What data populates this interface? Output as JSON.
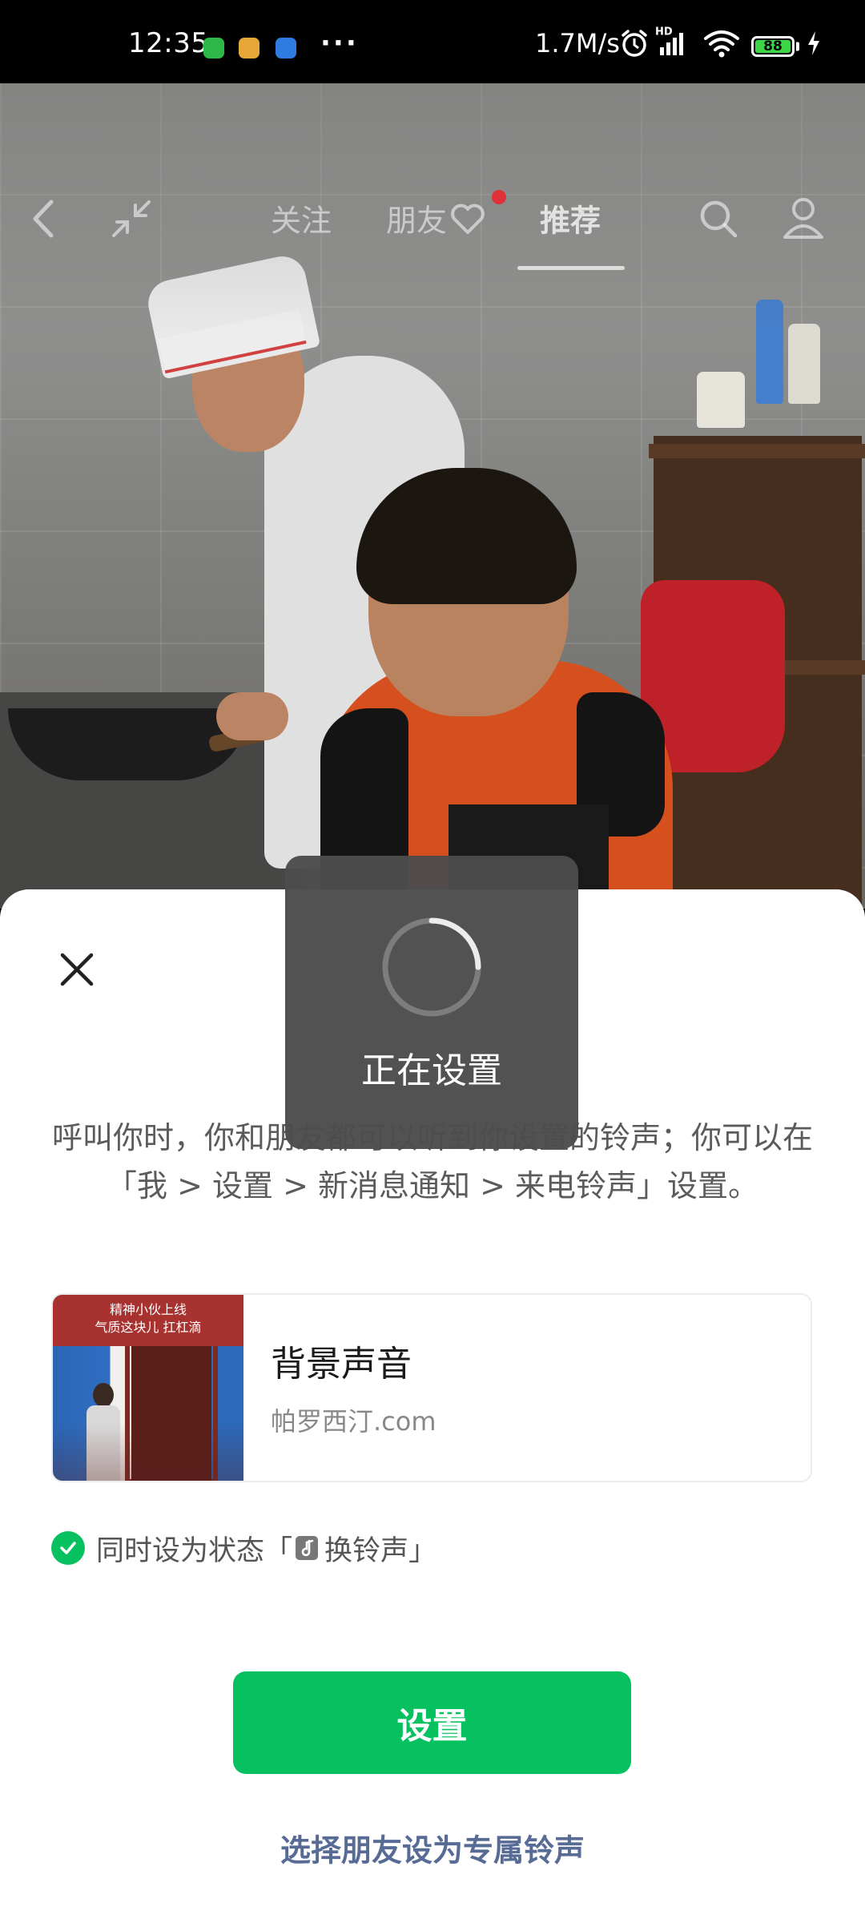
{
  "status_bar": {
    "time": "12:35",
    "dots": "···",
    "net_speed": "1.7M/s",
    "network_label": "HD",
    "battery": "88",
    "battery_color": "#3cd548"
  },
  "nav": {
    "tabs": [
      {
        "label": "关注"
      },
      {
        "label": "朋友"
      },
      {
        "label": "推荐"
      }
    ],
    "active_tab": "推荐",
    "icons": [
      "back-icon",
      "collapse-icon",
      "heart-icon",
      "search-icon",
      "profile-icon"
    ]
  },
  "loading": {
    "text": "正在设置"
  },
  "sheet": {
    "description": "呼叫你时，你和朋友都可以听到你设置的铃声；你可以在「我 > 设置 > 新消息通知 > 来电铃声」设置。",
    "ringtone": {
      "title": "背景声音",
      "subtitle": "帕罗西汀.com",
      "thumbnail_caption_line1": "精神小伙上线",
      "thumbnail_caption_line2": "气质这块儿 扛杠滴"
    },
    "status_option": {
      "checked": true,
      "prefix": "同时设为状态「",
      "label": "换铃声",
      "suffix": "」"
    },
    "set_button": "设置",
    "friend_link": "选择朋友设为专属铃声"
  },
  "colors": {
    "primary_green": "#07c160",
    "link_blue": "#576b95",
    "toast_bg": "#4c4c4c"
  }
}
